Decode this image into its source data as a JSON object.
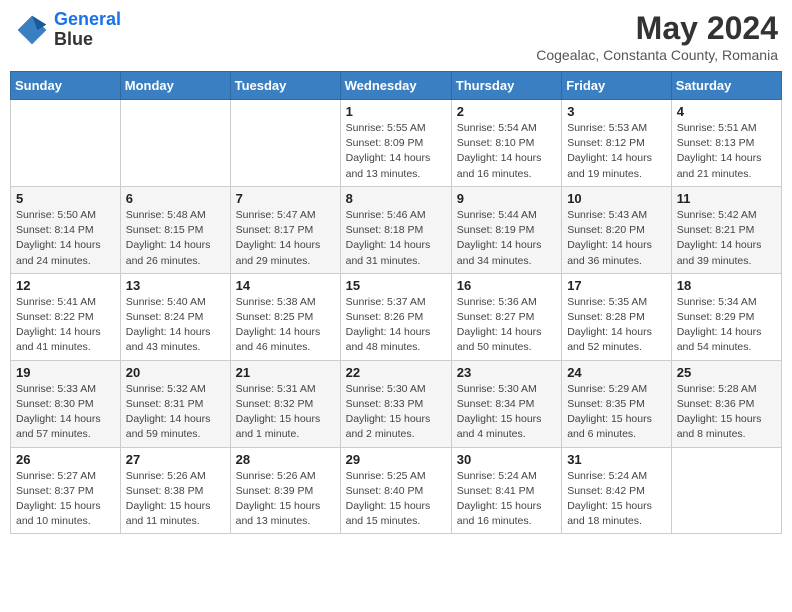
{
  "header": {
    "logo_line1": "General",
    "logo_line2": "Blue",
    "title": "May 2024",
    "subtitle": "Cogealac, Constanta County, Romania"
  },
  "calendar": {
    "days_of_week": [
      "Sunday",
      "Monday",
      "Tuesday",
      "Wednesday",
      "Thursday",
      "Friday",
      "Saturday"
    ],
    "weeks": [
      [
        {
          "day": "",
          "info": ""
        },
        {
          "day": "",
          "info": ""
        },
        {
          "day": "",
          "info": ""
        },
        {
          "day": "1",
          "info": "Sunrise: 5:55 AM\nSunset: 8:09 PM\nDaylight: 14 hours\nand 13 minutes."
        },
        {
          "day": "2",
          "info": "Sunrise: 5:54 AM\nSunset: 8:10 PM\nDaylight: 14 hours\nand 16 minutes."
        },
        {
          "day": "3",
          "info": "Sunrise: 5:53 AM\nSunset: 8:12 PM\nDaylight: 14 hours\nand 19 minutes."
        },
        {
          "day": "4",
          "info": "Sunrise: 5:51 AM\nSunset: 8:13 PM\nDaylight: 14 hours\nand 21 minutes."
        }
      ],
      [
        {
          "day": "5",
          "info": "Sunrise: 5:50 AM\nSunset: 8:14 PM\nDaylight: 14 hours\nand 24 minutes."
        },
        {
          "day": "6",
          "info": "Sunrise: 5:48 AM\nSunset: 8:15 PM\nDaylight: 14 hours\nand 26 minutes."
        },
        {
          "day": "7",
          "info": "Sunrise: 5:47 AM\nSunset: 8:17 PM\nDaylight: 14 hours\nand 29 minutes."
        },
        {
          "day": "8",
          "info": "Sunrise: 5:46 AM\nSunset: 8:18 PM\nDaylight: 14 hours\nand 31 minutes."
        },
        {
          "day": "9",
          "info": "Sunrise: 5:44 AM\nSunset: 8:19 PM\nDaylight: 14 hours\nand 34 minutes."
        },
        {
          "day": "10",
          "info": "Sunrise: 5:43 AM\nSunset: 8:20 PM\nDaylight: 14 hours\nand 36 minutes."
        },
        {
          "day": "11",
          "info": "Sunrise: 5:42 AM\nSunset: 8:21 PM\nDaylight: 14 hours\nand 39 minutes."
        }
      ],
      [
        {
          "day": "12",
          "info": "Sunrise: 5:41 AM\nSunset: 8:22 PM\nDaylight: 14 hours\nand 41 minutes."
        },
        {
          "day": "13",
          "info": "Sunrise: 5:40 AM\nSunset: 8:24 PM\nDaylight: 14 hours\nand 43 minutes."
        },
        {
          "day": "14",
          "info": "Sunrise: 5:38 AM\nSunset: 8:25 PM\nDaylight: 14 hours\nand 46 minutes."
        },
        {
          "day": "15",
          "info": "Sunrise: 5:37 AM\nSunset: 8:26 PM\nDaylight: 14 hours\nand 48 minutes."
        },
        {
          "day": "16",
          "info": "Sunrise: 5:36 AM\nSunset: 8:27 PM\nDaylight: 14 hours\nand 50 minutes."
        },
        {
          "day": "17",
          "info": "Sunrise: 5:35 AM\nSunset: 8:28 PM\nDaylight: 14 hours\nand 52 minutes."
        },
        {
          "day": "18",
          "info": "Sunrise: 5:34 AM\nSunset: 8:29 PM\nDaylight: 14 hours\nand 54 minutes."
        }
      ],
      [
        {
          "day": "19",
          "info": "Sunrise: 5:33 AM\nSunset: 8:30 PM\nDaylight: 14 hours\nand 57 minutes."
        },
        {
          "day": "20",
          "info": "Sunrise: 5:32 AM\nSunset: 8:31 PM\nDaylight: 14 hours\nand 59 minutes."
        },
        {
          "day": "21",
          "info": "Sunrise: 5:31 AM\nSunset: 8:32 PM\nDaylight: 15 hours\nand 1 minute."
        },
        {
          "day": "22",
          "info": "Sunrise: 5:30 AM\nSunset: 8:33 PM\nDaylight: 15 hours\nand 2 minutes."
        },
        {
          "day": "23",
          "info": "Sunrise: 5:30 AM\nSunset: 8:34 PM\nDaylight: 15 hours\nand 4 minutes."
        },
        {
          "day": "24",
          "info": "Sunrise: 5:29 AM\nSunset: 8:35 PM\nDaylight: 15 hours\nand 6 minutes."
        },
        {
          "day": "25",
          "info": "Sunrise: 5:28 AM\nSunset: 8:36 PM\nDaylight: 15 hours\nand 8 minutes."
        }
      ],
      [
        {
          "day": "26",
          "info": "Sunrise: 5:27 AM\nSunset: 8:37 PM\nDaylight: 15 hours\nand 10 minutes."
        },
        {
          "day": "27",
          "info": "Sunrise: 5:26 AM\nSunset: 8:38 PM\nDaylight: 15 hours\nand 11 minutes."
        },
        {
          "day": "28",
          "info": "Sunrise: 5:26 AM\nSunset: 8:39 PM\nDaylight: 15 hours\nand 13 minutes."
        },
        {
          "day": "29",
          "info": "Sunrise: 5:25 AM\nSunset: 8:40 PM\nDaylight: 15 hours\nand 15 minutes."
        },
        {
          "day": "30",
          "info": "Sunrise: 5:24 AM\nSunset: 8:41 PM\nDaylight: 15 hours\nand 16 minutes."
        },
        {
          "day": "31",
          "info": "Sunrise: 5:24 AM\nSunset: 8:42 PM\nDaylight: 15 hours\nand 18 minutes."
        },
        {
          "day": "",
          "info": ""
        }
      ]
    ]
  }
}
